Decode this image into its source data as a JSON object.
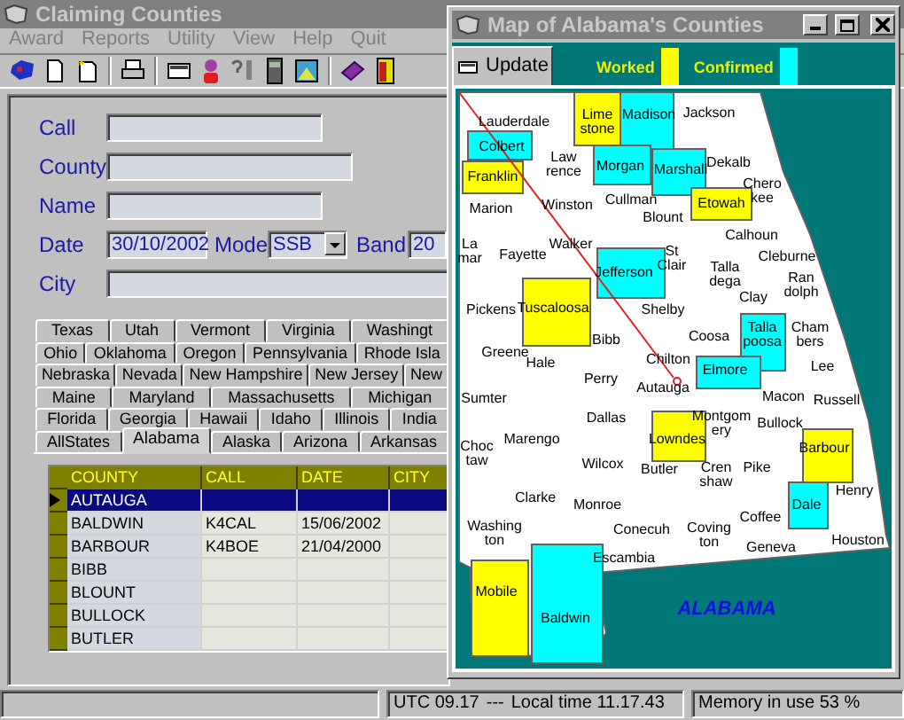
{
  "main_window": {
    "title": "Claiming Counties",
    "menu": [
      "Award",
      "Reports",
      "Utility",
      "View",
      "Help",
      "Quit"
    ]
  },
  "form": {
    "call": {
      "label": "Call"
    },
    "county": {
      "label": "County"
    },
    "name": {
      "label": "Name"
    },
    "date": {
      "label": "Date",
      "value": "30/10/2002"
    },
    "mode": {
      "label": "Mode",
      "value": "SSB"
    },
    "band": {
      "label": "Band",
      "value": "20"
    },
    "city": {
      "label": "City"
    }
  },
  "state_tabs": [
    [
      {
        "label": "Texas",
        "selected": false
      },
      {
        "label": "Utah",
        "selected": false
      },
      {
        "label": "Vermont",
        "selected": false
      },
      {
        "label": "Virginia",
        "selected": false
      },
      {
        "label": "Washingt",
        "selected": false
      }
    ],
    [
      {
        "label": "Ohio",
        "selected": false
      },
      {
        "label": "Oklahoma",
        "selected": false
      },
      {
        "label": "Oregon",
        "selected": false
      },
      {
        "label": "Pennsylvania",
        "selected": false
      },
      {
        "label": "Rhode Isla",
        "selected": false
      }
    ],
    [
      {
        "label": "Nebraska",
        "selected": false
      },
      {
        "label": "Nevada",
        "selected": false
      },
      {
        "label": "New Hampshire",
        "selected": false
      },
      {
        "label": "New Jersey",
        "selected": false
      },
      {
        "label": "New",
        "selected": false
      }
    ],
    [
      {
        "label": "Maine",
        "selected": false
      },
      {
        "label": "Maryland",
        "selected": false
      },
      {
        "label": "Massachusetts",
        "selected": false
      },
      {
        "label": "Michigan",
        "selected": false
      }
    ],
    [
      {
        "label": "Florida",
        "selected": false
      },
      {
        "label": "Georgia",
        "selected": false
      },
      {
        "label": "Hawaii",
        "selected": false
      },
      {
        "label": "Idaho",
        "selected": false
      },
      {
        "label": "Illinois",
        "selected": false
      },
      {
        "label": "India",
        "selected": false
      }
    ],
    [
      {
        "label": "AllStates",
        "selected": false
      },
      {
        "label": "Alabama",
        "selected": true
      },
      {
        "label": "Alaska",
        "selected": false
      },
      {
        "label": "Arizona",
        "selected": false
      },
      {
        "label": "Arkansas",
        "selected": false
      }
    ]
  ],
  "grid": {
    "columns": [
      "COUNTY",
      "CALL",
      "DATE",
      "CITY"
    ],
    "rows": [
      {
        "county": "AUTAUGA",
        "selected": true
      },
      {
        "county": "BALDWIN",
        "call": "K4CAL",
        "date": "15/06/2002",
        "selected": false
      },
      {
        "county": "BARBOUR",
        "call": "K4BOE",
        "date": "21/04/2000",
        "selected": false
      },
      {
        "county": "BIBB",
        "selected": false
      },
      {
        "county": "BLOUNT",
        "selected": false
      },
      {
        "county": "BULLOCK",
        "selected": false
      },
      {
        "county": "BUTLER",
        "selected": false
      }
    ]
  },
  "map_window": {
    "title": "Map of Alabama's Counties",
    "update_button": "Update",
    "legend": [
      {
        "label": "Worked",
        "color": "#ffff00"
      },
      {
        "label": "Confirmed",
        "color": "#00ffff"
      }
    ],
    "state_label": "ALABAMA",
    "counties": [
      {
        "label": "Lauderdale",
        "worked": false,
        "confirmed": false
      },
      {
        "label": "Lime stone",
        "worked": true,
        "confirmed": false
      },
      {
        "label": "Madison",
        "worked": false,
        "confirmed": true
      },
      {
        "label": "Jackson",
        "worked": false,
        "confirmed": false
      },
      {
        "label": "Colbert",
        "worked": false,
        "confirmed": true
      },
      {
        "label": "Law rence",
        "worked": false,
        "confirmed": false
      },
      {
        "label": "Morgan",
        "worked": false,
        "confirmed": true
      },
      {
        "label": "Marshall",
        "worked": false,
        "confirmed": true
      },
      {
        "label": "Dekalb",
        "worked": false,
        "confirmed": false
      },
      {
        "label": "Franklin",
        "worked": true,
        "confirmed": false
      },
      {
        "label": "Chero kee",
        "worked": false,
        "confirmed": false
      },
      {
        "label": "Etowah",
        "worked": true,
        "confirmed": false
      },
      {
        "label": "Marion",
        "worked": false,
        "confirmed": false
      },
      {
        "label": "Winston",
        "worked": false,
        "confirmed": false
      },
      {
        "label": "Cullman",
        "worked": false,
        "confirmed": false
      },
      {
        "label": "Blount",
        "worked": false,
        "confirmed": false
      },
      {
        "label": "Calhoun",
        "worked": false,
        "confirmed": false
      },
      {
        "label": "La mar",
        "worked": false,
        "confirmed": false
      },
      {
        "label": "Fayette",
        "worked": false,
        "confirmed": false
      },
      {
        "label": "Walker",
        "worked": false,
        "confirmed": false
      },
      {
        "label": "St Clair",
        "worked": false,
        "confirmed": false
      },
      {
        "label": "Cleburne",
        "worked": false,
        "confirmed": false
      },
      {
        "label": "Jefferson",
        "worked": false,
        "confirmed": true
      },
      {
        "label": "Talla dega",
        "worked": false,
        "confirmed": false
      },
      {
        "label": "Clay",
        "worked": false,
        "confirmed": false
      },
      {
        "label": "Ran dolph",
        "worked": false,
        "confirmed": false
      },
      {
        "label": "Pickens",
        "worked": false,
        "confirmed": false
      },
      {
        "label": "Tuscaloosa",
        "worked": true,
        "confirmed": false
      },
      {
        "label": "Shelby",
        "worked": false,
        "confirmed": false
      },
      {
        "label": "Bibb",
        "worked": false,
        "confirmed": false
      },
      {
        "label": "Coosa",
        "worked": false,
        "confirmed": false
      },
      {
        "label": "Talla poosa",
        "worked": false,
        "confirmed": true
      },
      {
        "label": "Cham bers",
        "worked": false,
        "confirmed": false
      },
      {
        "label": "Greene",
        "worked": false,
        "confirmed": false
      },
      {
        "label": "Hale",
        "worked": false,
        "confirmed": false
      },
      {
        "label": "Chilton",
        "worked": false,
        "confirmed": false
      },
      {
        "label": "Perry",
        "worked": false,
        "confirmed": false
      },
      {
        "label": "Elmore",
        "worked": false,
        "confirmed": true
      },
      {
        "label": "Lee",
        "worked": false,
        "confirmed": false
      },
      {
        "label": "Sumter",
        "worked": false,
        "confirmed": false
      },
      {
        "label": "Autauga",
        "worked": false,
        "confirmed": false
      },
      {
        "label": "Macon",
        "worked": false,
        "confirmed": false
      },
      {
        "label": "Russell",
        "worked": false,
        "confirmed": false
      },
      {
        "label": "Dallas",
        "worked": false,
        "confirmed": false
      },
      {
        "label": "Montgom ery",
        "worked": false,
        "confirmed": false
      },
      {
        "label": "Bullock",
        "worked": false,
        "confirmed": false
      },
      {
        "label": "Choc taw",
        "worked": false,
        "confirmed": false
      },
      {
        "label": "Marengo",
        "worked": false,
        "confirmed": false
      },
      {
        "label": "Lowndes",
        "worked": true,
        "confirmed": false
      },
      {
        "label": "Barbour",
        "worked": true,
        "confirmed": false
      },
      {
        "label": "Wilcox",
        "worked": false,
        "confirmed": false
      },
      {
        "label": "Butler",
        "worked": false,
        "confirmed": false
      },
      {
        "label": "Cren shaw",
        "worked": false,
        "confirmed": false
      },
      {
        "label": "Pike",
        "worked": false,
        "confirmed": false
      },
      {
        "label": "Clarke",
        "worked": false,
        "confirmed": false
      },
      {
        "label": "Monroe",
        "worked": false,
        "confirmed": false
      },
      {
        "label": "Dale",
        "worked": false,
        "confirmed": true
      },
      {
        "label": "Henry",
        "worked": false,
        "confirmed": false
      },
      {
        "label": "Washing ton",
        "worked": false,
        "confirmed": false
      },
      {
        "label": "Conecuh",
        "worked": false,
        "confirmed": false
      },
      {
        "label": "Coving ton",
        "worked": false,
        "confirmed": false
      },
      {
        "label": "Coffee",
        "worked": false,
        "confirmed": false
      },
      {
        "label": "Escambia",
        "worked": false,
        "confirmed": false
      },
      {
        "label": "Geneva",
        "worked": false,
        "confirmed": false
      },
      {
        "label": "Houston",
        "worked": false,
        "confirmed": false
      },
      {
        "label": "Mobile",
        "worked": true,
        "confirmed": false
      },
      {
        "label": "Baldwin",
        "worked": false,
        "confirmed": true
      }
    ]
  },
  "status_bar": {
    "utc": "UTC 09.17",
    "separator": "---",
    "local": "Local time 11.17.43",
    "memory": "Memory in use 53 %"
  }
}
